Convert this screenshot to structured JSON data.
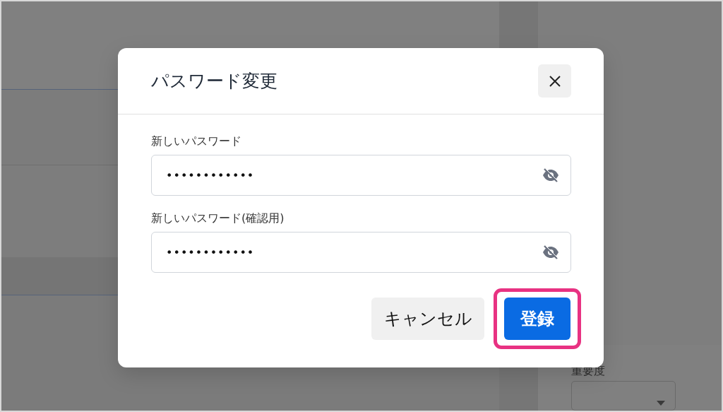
{
  "background": {
    "field_label": "重要度"
  },
  "dialog": {
    "title": "パスワード変更",
    "fields": [
      {
        "label": "新しいパスワード",
        "value": "••••••••••••",
        "revealed": false
      },
      {
        "label": "新しいパスワード(確認用)",
        "value": "••••••••••••",
        "revealed": false
      }
    ],
    "buttons": [
      {
        "label": "キャンセル",
        "kind": "secondary",
        "highlighted": false
      },
      {
        "label": "登録",
        "kind": "primary",
        "highlighted": true
      }
    ]
  }
}
